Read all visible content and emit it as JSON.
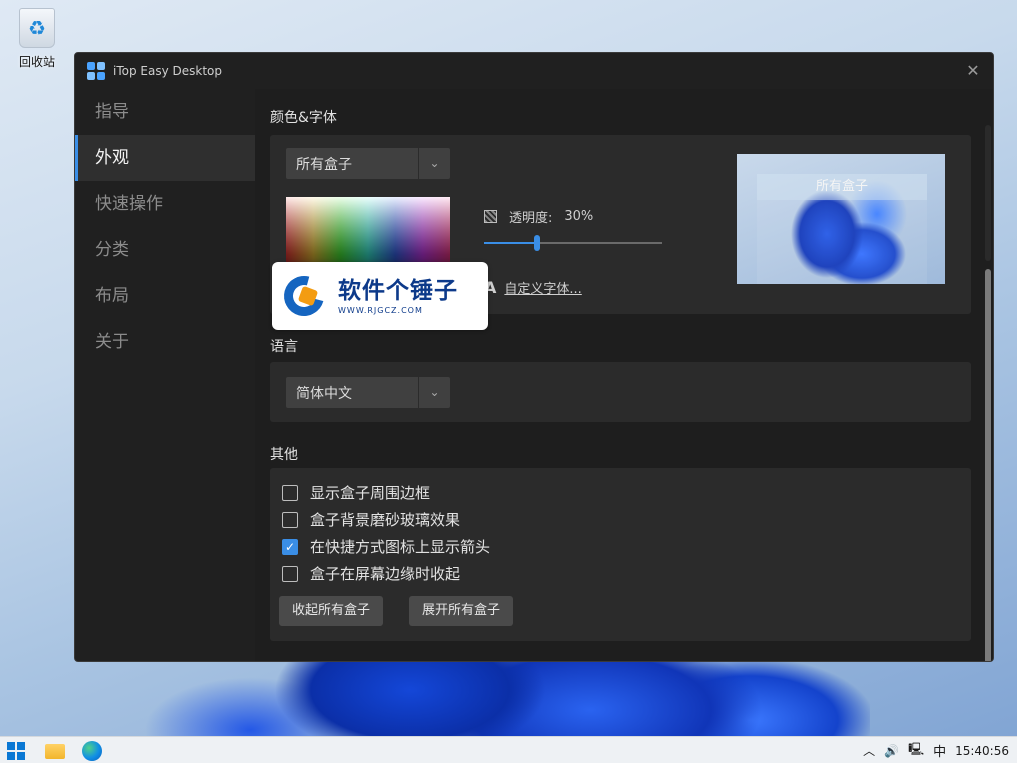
{
  "desktop": {
    "recycle_bin_label": "回收站"
  },
  "window": {
    "title": "iTop Easy Desktop",
    "close_glyph": "✕"
  },
  "sidebar": {
    "items": [
      {
        "label": "指导",
        "active": false
      },
      {
        "label": "外观",
        "active": true
      },
      {
        "label": "快速操作",
        "active": false
      },
      {
        "label": "分类",
        "active": false
      },
      {
        "label": "布局",
        "active": false
      },
      {
        "label": "关于",
        "active": false
      }
    ]
  },
  "color_font": {
    "title": "颜色&字体",
    "box_select": {
      "value": "所有盒子",
      "arrow": "⌄"
    },
    "opacity_label": "透明度:",
    "opacity_value": "30%",
    "opacity_fraction": 0.3,
    "custom_font_label": "自定义字体...",
    "font_icon": "A",
    "preview_box_label": "所有盒子"
  },
  "watermark": {
    "brand_text": "软件个锤子",
    "url": "WWW.RJGCZ.COM"
  },
  "language": {
    "title": "语言",
    "select": {
      "value": "简体中文",
      "arrow": "⌄"
    }
  },
  "other": {
    "title": "其他",
    "options": [
      {
        "label": "显示盒子周围边框",
        "checked": false
      },
      {
        "label": "盒子背景磨砂玻璃效果",
        "checked": false
      },
      {
        "label": "在快捷方式图标上显示箭头",
        "checked": true
      },
      {
        "label": "盒子在屏幕边缘时收起",
        "checked": false
      }
    ],
    "collapse_all_button": "收起所有盒子",
    "expand_all_button": "展开所有盒子"
  },
  "taskbar": {
    "chevron": "︿",
    "volume_icon": "🔊",
    "network_icon": "🖳",
    "ime": "中",
    "time": "15:40:56"
  },
  "colors": {
    "accent": "#3a8ee6",
    "window_bg": "#202020",
    "panel_bg": "#2b2b2b"
  }
}
